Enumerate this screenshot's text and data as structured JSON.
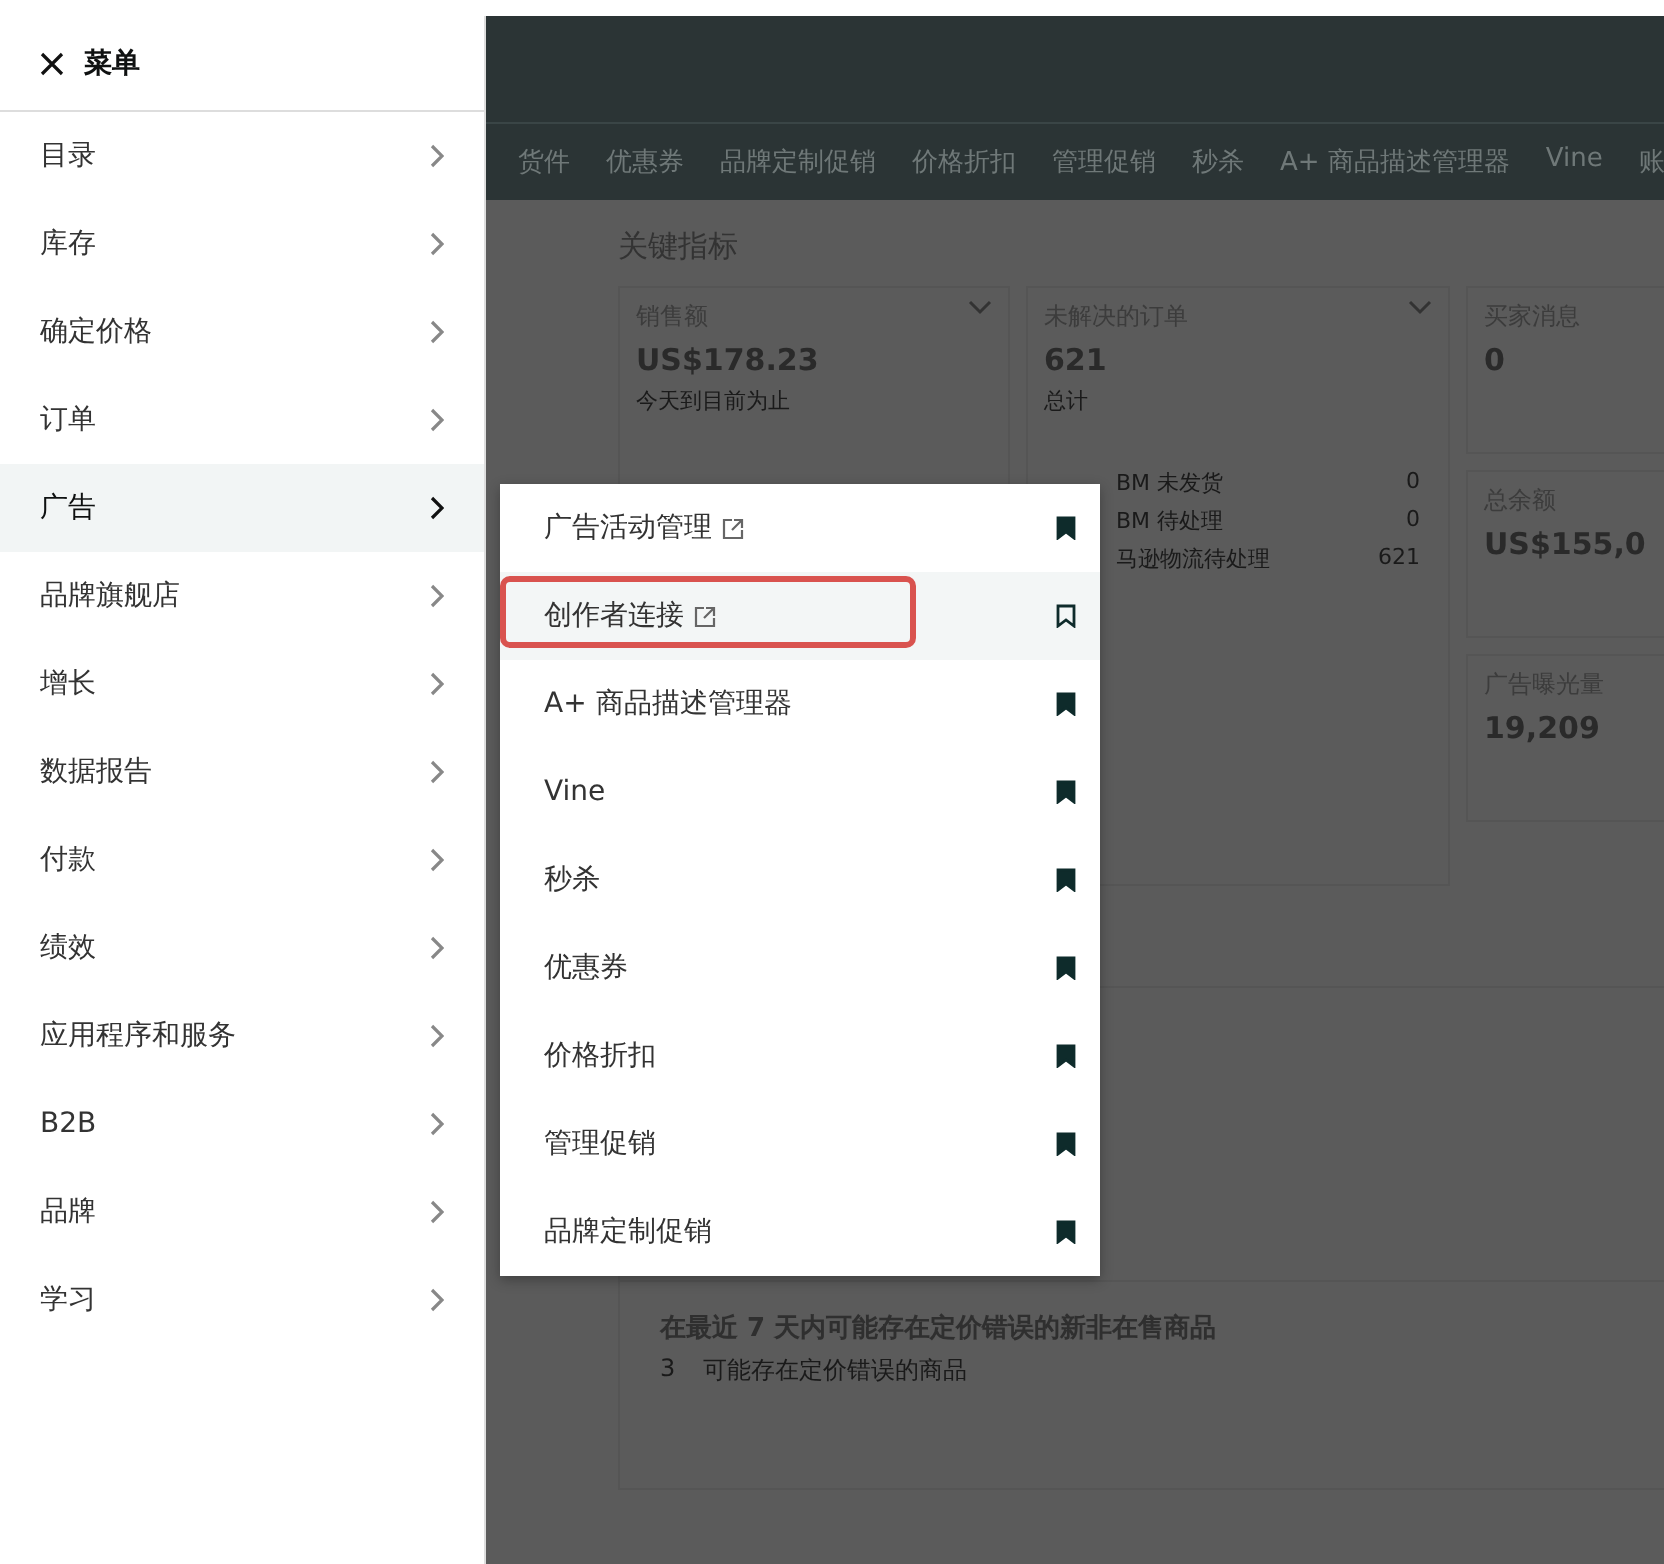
{
  "menu": {
    "title": "菜单",
    "items": [
      {
        "label": "目录",
        "selected": false
      },
      {
        "label": "库存",
        "selected": false
      },
      {
        "label": "确定价格",
        "selected": false
      },
      {
        "label": "订单",
        "selected": false
      },
      {
        "label": "广告",
        "selected": true
      },
      {
        "label": "品牌旗舰店",
        "selected": false
      },
      {
        "label": "增长",
        "selected": false
      },
      {
        "label": "数据报告",
        "selected": false
      },
      {
        "label": "付款",
        "selected": false
      },
      {
        "label": "绩效",
        "selected": false
      },
      {
        "label": "应用程序和服务",
        "selected": false
      },
      {
        "label": "B2B",
        "selected": false
      },
      {
        "label": "品牌",
        "selected": false
      },
      {
        "label": "学习",
        "selected": false
      }
    ]
  },
  "submenu": {
    "items": [
      {
        "label": "广告活动管理",
        "external": true,
        "bookmarked": true,
        "highlighted": false
      },
      {
        "label": "创作者连接",
        "external": true,
        "bookmarked": false,
        "highlighted": true
      },
      {
        "label": "A+ 商品描述管理器",
        "external": false,
        "bookmarked": true,
        "highlighted": false
      },
      {
        "label": "Vine",
        "external": false,
        "bookmarked": true,
        "highlighted": false
      },
      {
        "label": "秒杀",
        "external": false,
        "bookmarked": true,
        "highlighted": false
      },
      {
        "label": "优惠券",
        "external": false,
        "bookmarked": true,
        "highlighted": false
      },
      {
        "label": "价格折扣",
        "external": false,
        "bookmarked": true,
        "highlighted": false
      },
      {
        "label": "管理促销",
        "external": false,
        "bookmarked": true,
        "highlighted": false
      },
      {
        "label": "品牌定制促销",
        "external": false,
        "bookmarked": true,
        "highlighted": false
      }
    ]
  },
  "nav": [
    "货件",
    "优惠券",
    "品牌定制促销",
    "价格折扣",
    "管理促销",
    "秒杀",
    "A+ 商品描述管理器",
    "Vine",
    "账"
  ],
  "dashboard": {
    "title": "关键指标",
    "sales": {
      "label": "销售额",
      "value": "US$178.23",
      "caption": "今天到目前为止"
    },
    "orders": {
      "label": "未解决的订单",
      "value": "621",
      "caption": "总计",
      "rows": [
        {
          "label": "BM 未发货",
          "value": "0"
        },
        {
          "label": "BM 待处理",
          "value": "0"
        },
        {
          "label": "马逊物流待处理",
          "value": "621"
        }
      ]
    },
    "messages": {
      "label": "买家消息",
      "value": "0"
    },
    "balance": {
      "label": "总余额",
      "value": "US$155,0"
    },
    "impressions": {
      "label": "广告曝光量",
      "value": "19,209"
    },
    "pricing": {
      "title": "在最近 7 天内可能存在定价错误的新非在售商品",
      "count": "3",
      "caption": "可能存在定价错误的商品"
    }
  }
}
